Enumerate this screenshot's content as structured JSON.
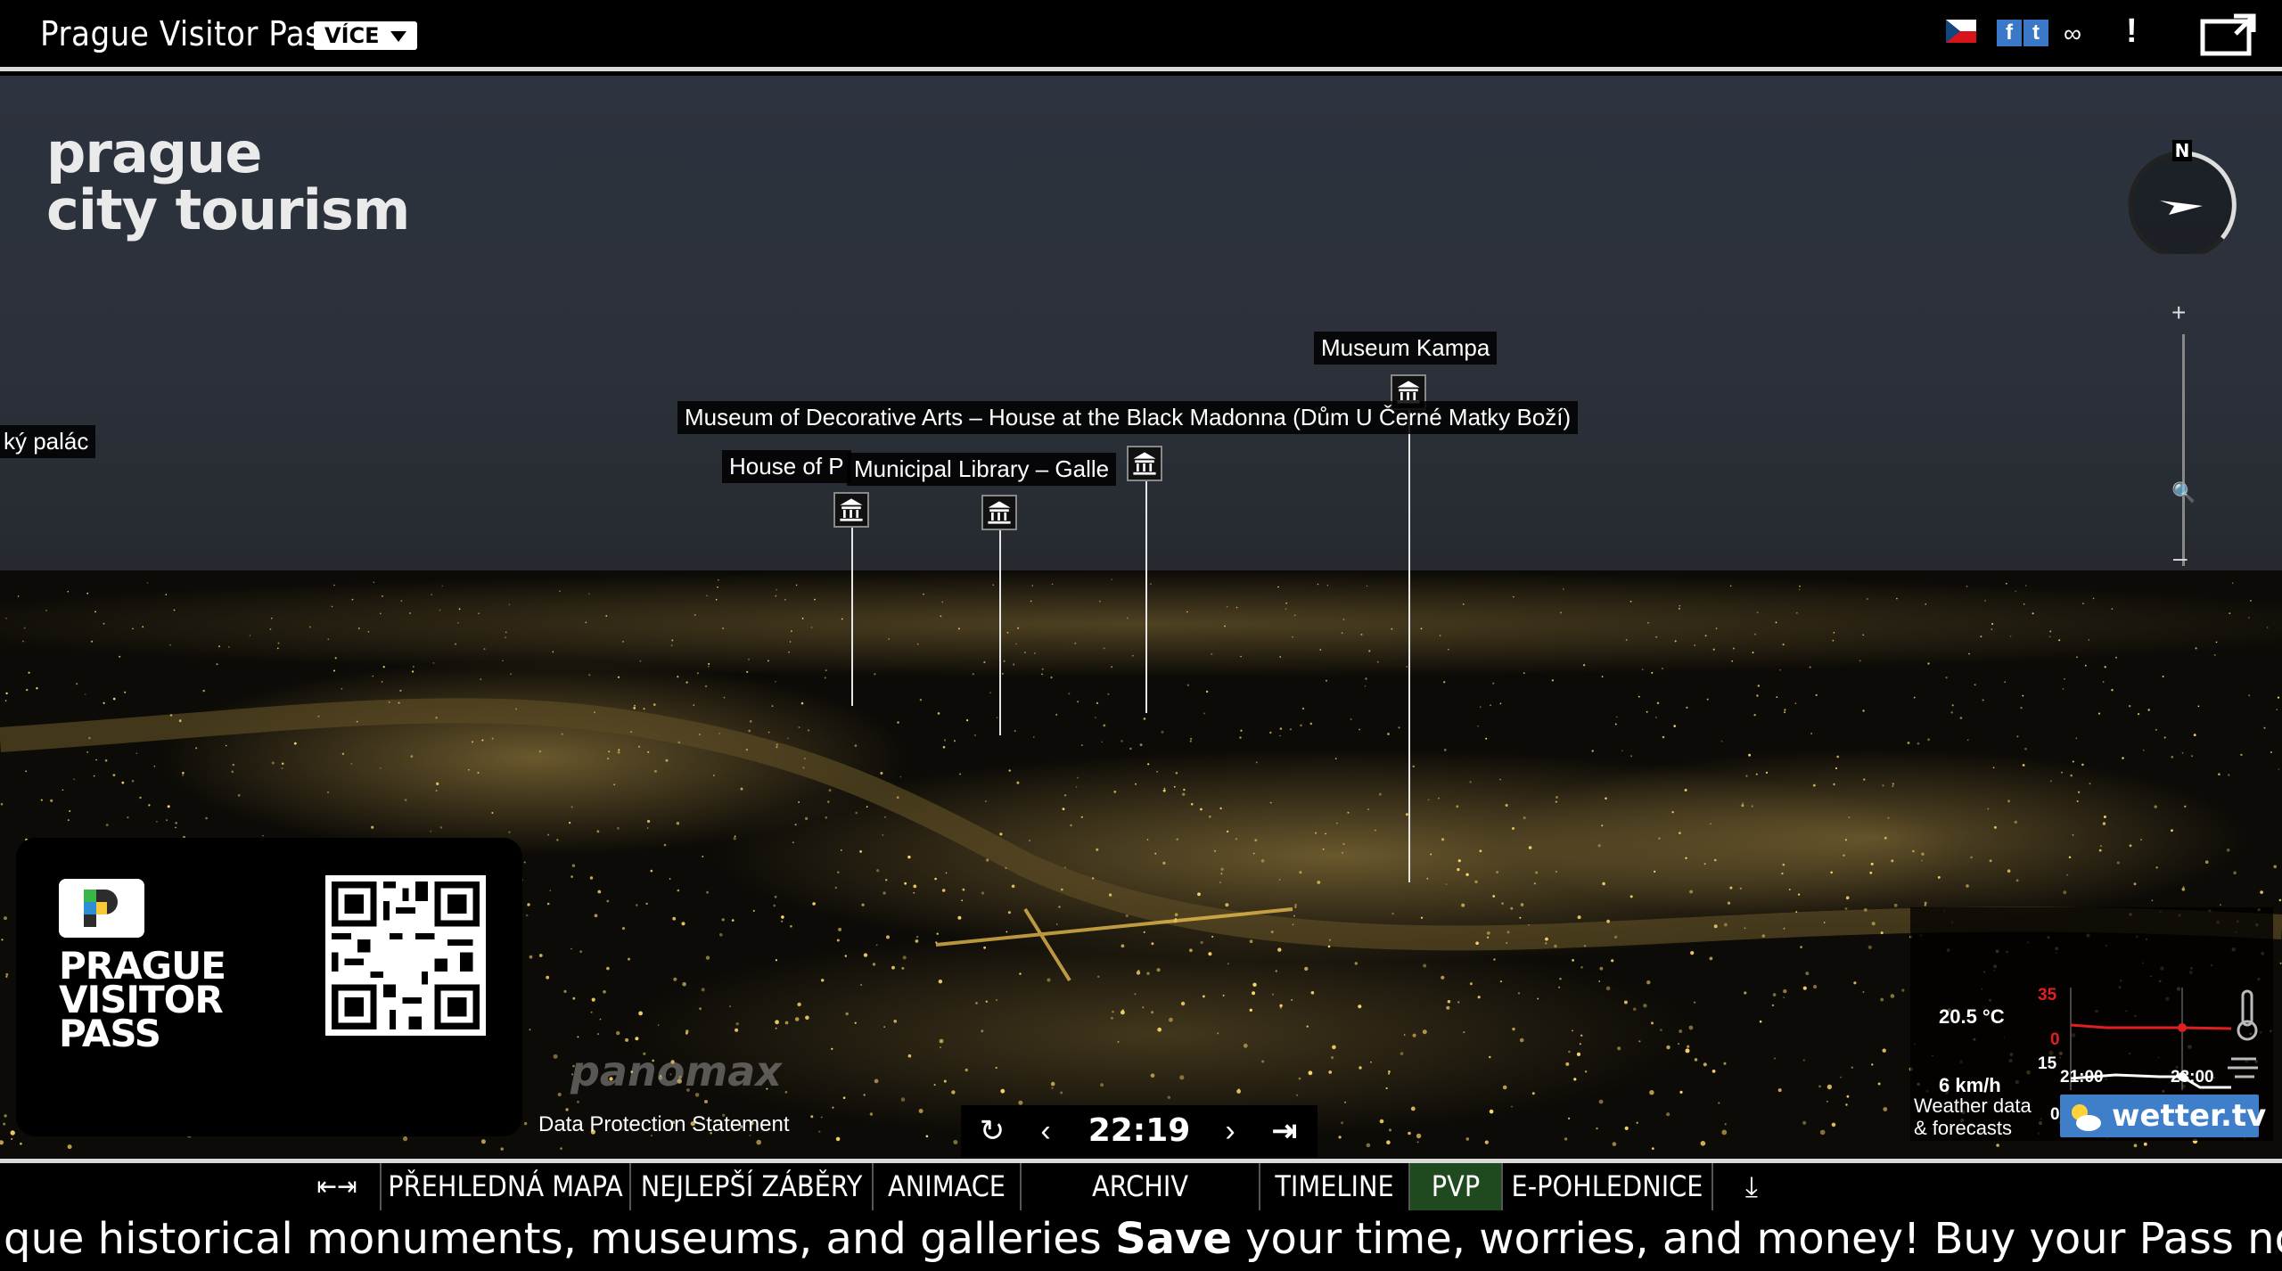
{
  "header": {
    "title": "Prague Visitor Pass",
    "more_label": "VÍCE"
  },
  "panorama": {
    "logo_line1": "prague",
    "logo_line2": "city tourism",
    "pois": [
      {
        "label": "ký palác"
      },
      {
        "label": "Museum Kampa"
      },
      {
        "label": "Museum of Decorative Arts – House at the Black Madonna (Dům U Černé Matky Boží)"
      },
      {
        "label": "House of P"
      },
      {
        "label": "Municipal Library – Galle"
      }
    ],
    "compass_label": "N",
    "zoom_plus": "+",
    "zoom_minus": "–",
    "promo": {
      "line1": "PRAGUE",
      "line2": "VISITOR",
      "line3": "PASS"
    },
    "watermark": "panomax",
    "data_protection": "Data Protection Statement",
    "time": "22:19",
    "weather": {
      "temperature": "20.5 °C",
      "wind": "6 km/h",
      "temp_max": "35",
      "temp_min": "0",
      "wind_max": "15",
      "wind_min": "0",
      "time_start": "21:00",
      "time_end": "23:00",
      "footer_line1": "Weather data",
      "footer_line2": "& forecasts",
      "brand": "wetter.tv"
    }
  },
  "nav": {
    "items": [
      {
        "label": "PŘEHLEDNÁ MAPA"
      },
      {
        "label": "NEJLEPŠÍ ZÁBĚRY"
      },
      {
        "label": "ANIMACE"
      },
      {
        "label": "ARCHIV"
      },
      {
        "label": "TIMELINE"
      },
      {
        "label": "PVP"
      },
      {
        "label": "E-POHLEDNICE"
      }
    ],
    "active_index": 5
  },
  "ticker": {
    "text_before": "que historical monuments, museums, and galleries ",
    "text_bold": "Save",
    "text_after": " your time, worries, and money! Buy your Pass now and sta"
  },
  "colors": {
    "accent_active": "#1f4a1f",
    "weather_brand": "#3f7ec9",
    "temp_line": "#e02020"
  }
}
